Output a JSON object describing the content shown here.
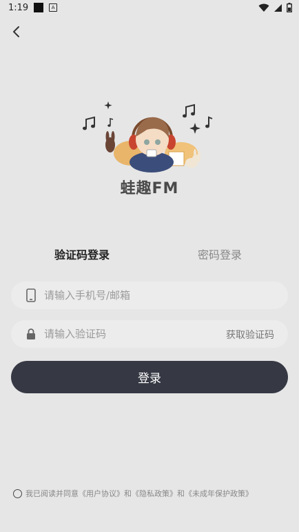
{
  "status_bar": {
    "time": "1:19",
    "icons": [
      "notification-square-icon",
      "a-app-icon",
      "wifi-icon",
      "signal-icon",
      "battery-icon"
    ]
  },
  "header": {
    "back_icon": "chevron-left-icon"
  },
  "brand": {
    "app_name": "蛙趣FM",
    "illustration": "anime-mascot-with-headphones"
  },
  "tabs": [
    {
      "label": "验证码登录",
      "active": true
    },
    {
      "label": "密码登录",
      "active": false
    }
  ],
  "form": {
    "phone_placeholder": "请输入手机号/邮箱",
    "phone_value": "",
    "phone_icon": "phone-icon",
    "code_placeholder": "请输入验证码",
    "code_value": "",
    "code_icon": "lock-icon",
    "get_code_label": "获取验证码",
    "login_label": "登录"
  },
  "agreement": {
    "prefix": "我已阅读并同意",
    "user_agreement": "《用户协议》",
    "and1": "和",
    "privacy_policy": "《隐私政策》",
    "and2": "和",
    "minor_policy": "《未成年保护政策》"
  },
  "colors": {
    "background": "#e6e6e6",
    "field_bg": "#ececec",
    "button_bg": "#363944",
    "button_text": "#ffffff"
  }
}
